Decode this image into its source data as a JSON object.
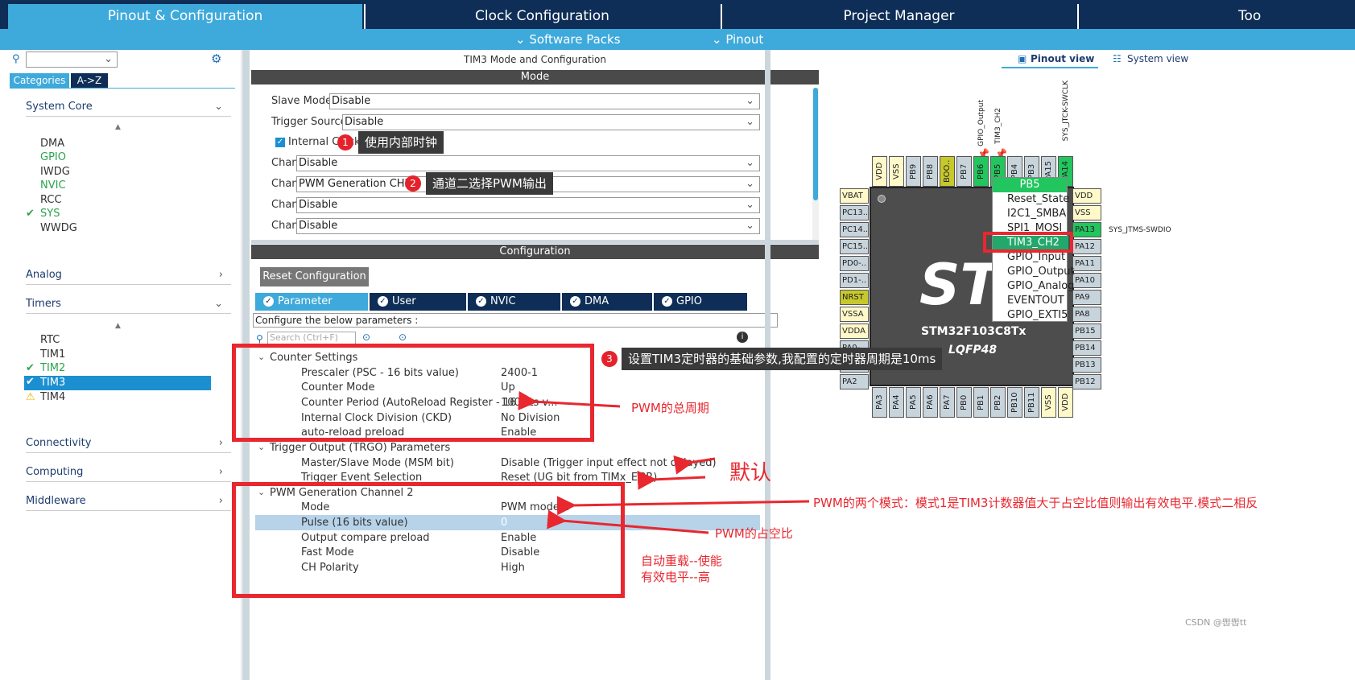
{
  "top_tabs": [
    "Pinout & Configuration",
    "Clock Configuration",
    "Project Manager",
    "Too"
  ],
  "sub_tabs": [
    "Software Packs",
    "Pinout"
  ],
  "left": {
    "tabs": [
      "Categories",
      "A->Z"
    ],
    "categories": [
      "System Core",
      "Analog",
      "Timers",
      "Connectivity",
      "Computing",
      "Middleware"
    ],
    "system_core_items": [
      "DMA",
      "GPIO",
      "IWDG",
      "NVIC",
      "RCC",
      "SYS",
      "WWDG"
    ],
    "timer_items": [
      "RTC",
      "TIM1",
      "TIM2",
      "TIM3",
      "TIM4"
    ]
  },
  "mid": {
    "title": "TIM3 Mode and Configuration",
    "mode_header": "Mode",
    "mode_rows": [
      {
        "label": "Slave Mode",
        "value": "Disable"
      },
      {
        "label": "Trigger Source",
        "value": "Disable"
      },
      {
        "label": "Channel1",
        "value": "Disable"
      },
      {
        "label": "Channel2",
        "value": "PWM Generation CH2"
      },
      {
        "label": "Channel3",
        "value": "Disable"
      },
      {
        "label": "Channel4",
        "value": "Disable"
      }
    ],
    "internal_clock": "Internal Clock",
    "config_header": "Configuration",
    "reset_button": "Reset Configuration",
    "config_tabs": [
      "Parameter Settings",
      "User Constants",
      "NVIC Settings",
      "DMA Settings",
      "GPIO Settings"
    ],
    "configure_text": "Configure the below parameters :",
    "search_placeholder": "Search (Ctrl+F)",
    "groups": [
      {
        "title": "Counter Settings",
        "params": [
          {
            "name": "Prescaler (PSC - 16 bits value)",
            "value": "2400-1"
          },
          {
            "name": "Counter Mode",
            "value": "Up"
          },
          {
            "name": "Counter Period (AutoReload Register - 16 bits v...",
            "value": "100-1"
          },
          {
            "name": "Internal Clock Division (CKD)",
            "value": "No Division"
          },
          {
            "name": "auto-reload preload",
            "value": "Enable"
          }
        ]
      },
      {
        "title": "Trigger Output (TRGO) Parameters",
        "params": [
          {
            "name": "Master/Slave Mode (MSM bit)",
            "value": "Disable (Trigger input effect not delayed)"
          },
          {
            "name": "Trigger Event Selection",
            "value": "Reset (UG bit from TIMx_EGR)"
          }
        ]
      },
      {
        "title": "PWM Generation Channel 2",
        "params": [
          {
            "name": "Mode",
            "value": "PWM mode 1"
          },
          {
            "name": "Pulse (16 bits value)",
            "value": "0"
          },
          {
            "name": "Output compare preload",
            "value": "Enable"
          },
          {
            "name": "Fast Mode",
            "value": "Disable"
          },
          {
            "name": "CH Polarity",
            "value": "High"
          }
        ]
      }
    ]
  },
  "annotations": {
    "callout1": "使用内部时钟",
    "callout2": "通道二选择PWM输出",
    "callout3": "设置TIM3定时器的基础参数,我配置的定时器周期是10ms",
    "badge1": "1",
    "badge2": "2",
    "badge3": "3",
    "pwm_period": "PWM的总周期",
    "default": "默认",
    "pwm_modes": "PWM的两个模式：模式1是TIM3计数器值大于占空比值则输出有效电平.模式二相反",
    "pwm_duty": "PWM的占空比",
    "auto_reload": "自动重载--使能",
    "active_level": "有效电平--高"
  },
  "right": {
    "view_tabs": [
      "Pinout view",
      "System view"
    ],
    "chip_name": "STM32F103C8Tx",
    "package": "LQFP48",
    "top_pins": [
      "VDD",
      "VSS",
      "PB9",
      "PB8",
      "BOO..",
      "PB6",
      "PB5",
      "PB4",
      "PB3",
      "PA15",
      "PA14"
    ],
    "top_labels": [
      "GPIO_Output",
      "TIM3_CH2",
      "SYS_JTCK-SWCLK"
    ],
    "left_pins": [
      "VBAT",
      "PC13..",
      "PC14..",
      "PC15..",
      "PD0-..",
      "PD1-..",
      "NRST",
      "VSSA",
      "VDDA",
      "PA0-..",
      "PA1",
      "PA2"
    ],
    "right_pins": [
      "VDD",
      "VSS",
      "PA13",
      "PA12",
      "PA11",
      "PA10",
      "PA9",
      "PA8",
      "PB15",
      "PB14",
      "PB13",
      "PB12"
    ],
    "right_label": "SYS_JTMS-SWDIO",
    "bottom_pins": [
      "PA3",
      "PA4",
      "PA5",
      "PA6",
      "PA7",
      "PB0",
      "PB1",
      "PB2",
      "PB10",
      "PB11",
      "VSS",
      "VDD"
    ],
    "menu_title": "PB5",
    "menu_items": [
      "Reset_State",
      "I2C1_SMBA",
      "SPI1_MOSI",
      "TIM3_CH2",
      "GPIO_Input",
      "GPIO_Output",
      "GPIO_Analog",
      "EVENTOUT",
      "GPIO_EXTI5"
    ]
  },
  "watermark": "CSDN @辔辔tt"
}
